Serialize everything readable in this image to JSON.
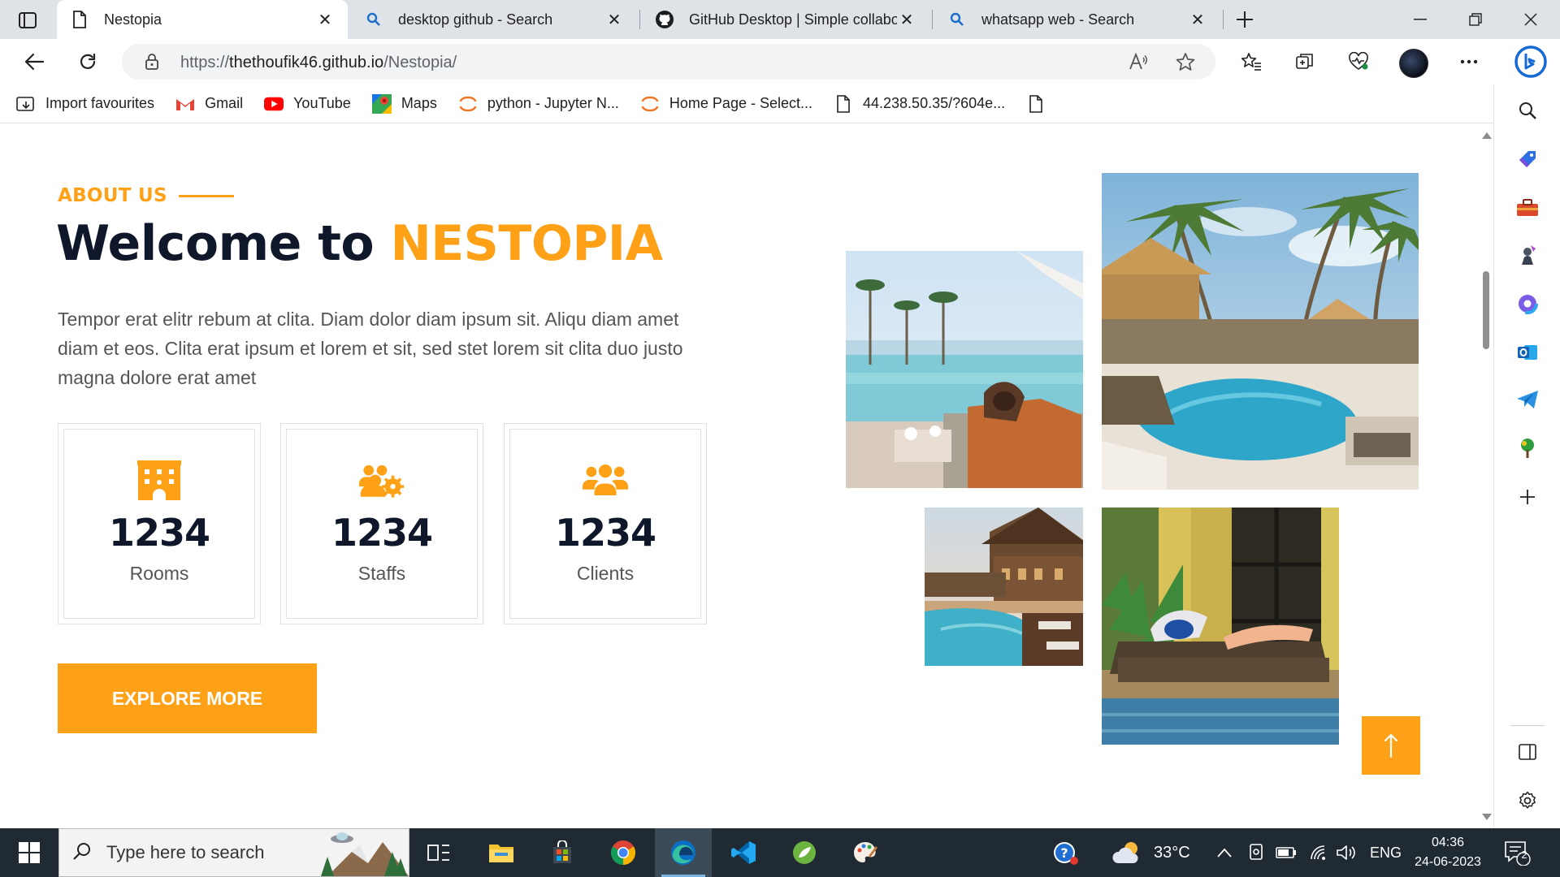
{
  "browser": {
    "tabs": [
      {
        "title": "Nestopia",
        "icon": "page-icon",
        "active": true
      },
      {
        "title": "desktop github - Search",
        "icon": "search-icon",
        "active": false
      },
      {
        "title": "GitHub Desktop | Simple collaboration",
        "icon": "github-icon",
        "active": false
      },
      {
        "title": "whatsapp web - Search",
        "icon": "search-icon",
        "active": false
      }
    ],
    "url": {
      "scheme": "https://",
      "host": "thethoufik46.github.io",
      "path": "/Nestopia/"
    },
    "favorites": [
      {
        "label": "Import favourites",
        "icon": "import-icon"
      },
      {
        "label": "Gmail",
        "icon": "gmail-icon"
      },
      {
        "label": "YouTube",
        "icon": "youtube-icon"
      },
      {
        "label": "Maps",
        "icon": "maps-icon"
      },
      {
        "label": "python - Jupyter N...",
        "icon": "jupyter-icon"
      },
      {
        "label": "Home Page - Select...",
        "icon": "jupyter-icon"
      },
      {
        "label": "44.238.50.35/?604e...",
        "icon": "page-icon"
      },
      {
        "label": "",
        "icon": "page-icon"
      }
    ],
    "sidebar_icons": [
      "search-icon",
      "shopping-tag-icon",
      "toolbox-icon",
      "games-icon",
      "office-icon",
      "outlook-icon",
      "telegram-icon",
      "tree-icon",
      "add-icon",
      "split-screen-icon",
      "settings-icon"
    ]
  },
  "page": {
    "about_label": "ABOUT US",
    "headline_prefix": "Welcome to ",
    "headline_brand": "NESTOPIA",
    "intro": "Tempor erat elitr rebum at clita. Diam dolor diam ipsum sit. Aliqu diam amet diam et eos. Clita erat ipsum et lorem et sit, sed stet lorem sit clita duo justo magna dolore erat amet",
    "stats": [
      {
        "value": "1234",
        "label": "Rooms",
        "icon": "hotel-icon"
      },
      {
        "value": "1234",
        "label": "Staffs",
        "icon": "users-cog-icon"
      },
      {
        "value": "1234",
        "label": "Clients",
        "icon": "users-icon"
      }
    ],
    "cta_label": "EXPLORE MORE",
    "accent_color": "#FEA116",
    "dark_color": "#0F172B"
  },
  "taskbar": {
    "search_placeholder": "Type here to search",
    "apps": [
      "task-view-icon",
      "file-explorer-icon",
      "store-icon",
      "chrome-icon",
      "edge-icon",
      "vscode-icon",
      "spring-icon",
      "paint-icon"
    ],
    "weather": "33°C",
    "language": "ENG",
    "time": "04:36",
    "date": "24-06-2023",
    "notification_count": "2"
  }
}
